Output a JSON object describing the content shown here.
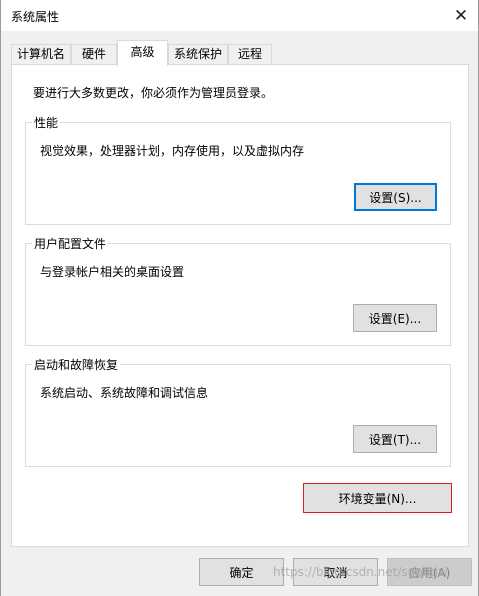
{
  "window": {
    "title": "系统属性",
    "close_glyph": "✕"
  },
  "tabs": [
    {
      "label": "计算机名",
      "active": false
    },
    {
      "label": "硬件",
      "active": false
    },
    {
      "label": "高级",
      "active": true
    },
    {
      "label": "系统保护",
      "active": false
    },
    {
      "label": "远程",
      "active": false
    }
  ],
  "advanced": {
    "notice": "要进行大多数更改，你必须作为管理员登录。",
    "performance": {
      "title": "性能",
      "description": "视觉效果，处理器计划，内存使用，以及虚拟内存",
      "button": "设置(S)..."
    },
    "profiles": {
      "title": "用户配置文件",
      "description": "与登录帐户相关的桌面设置",
      "button": "设置(E)..."
    },
    "startup": {
      "title": "启动和故障恢复",
      "description": "系统启动、系统故障和调试信息",
      "button": "设置(T)..."
    },
    "env_button": "环境变量(N)..."
  },
  "footer": {
    "ok": "确定",
    "cancel": "取消",
    "apply": "应用(A)"
  },
  "watermark": "https://blog.csdn.net/sgongzi",
  "colors": {
    "focus_border": "#0078d7",
    "highlight_border": "#d81e1e"
  },
  "icons": {
    "close": "close-icon"
  }
}
